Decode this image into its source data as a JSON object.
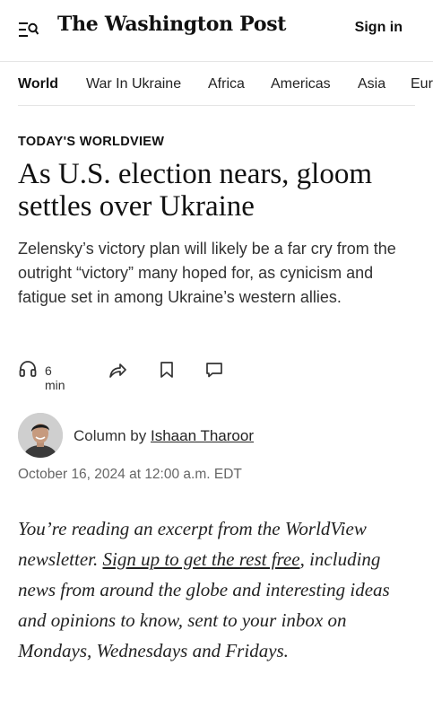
{
  "header": {
    "logo": "The Washington Post",
    "sign_in": "Sign in"
  },
  "nav": {
    "items": [
      {
        "label": "World",
        "active": true
      },
      {
        "label": "War In Ukraine",
        "active": false
      },
      {
        "label": "Africa",
        "active": false
      },
      {
        "label": "Americas",
        "active": false
      },
      {
        "label": "Asia",
        "active": false
      },
      {
        "label": "Eur",
        "active": false
      }
    ]
  },
  "article": {
    "kicker": "TODAY'S WORLDVIEW",
    "headline": "As U.S. election nears, gloom settles over Ukraine",
    "deck": "Zelensky’s victory plan will likely be a far cry from the outright “victory” many hoped for, as cynicism and fatigue set in among Ukraine’s western allies.",
    "listen_time": "6 min",
    "byline_prefix": "Column by",
    "author": "Ishaan Tharoor",
    "date": "October 16, 2024 at 12:00 a.m. EDT"
  },
  "excerpt": {
    "part1": "You’re reading an excerpt from the WorldView newsletter. ",
    "link": "Sign up to get the rest free",
    "part2": ", including news from around the globe and interesting ideas and opinions to know, sent to your inbox on Mondays, Wednesdays and Fridays."
  },
  "icons": {
    "menu": "menu-search-icon",
    "listen": "headphones-icon",
    "share": "share-icon",
    "save": "bookmark-icon",
    "comment": "comment-icon"
  },
  "colors": {
    "text": "#111111",
    "muted": "#666666",
    "divider": "#e5e5e5"
  }
}
